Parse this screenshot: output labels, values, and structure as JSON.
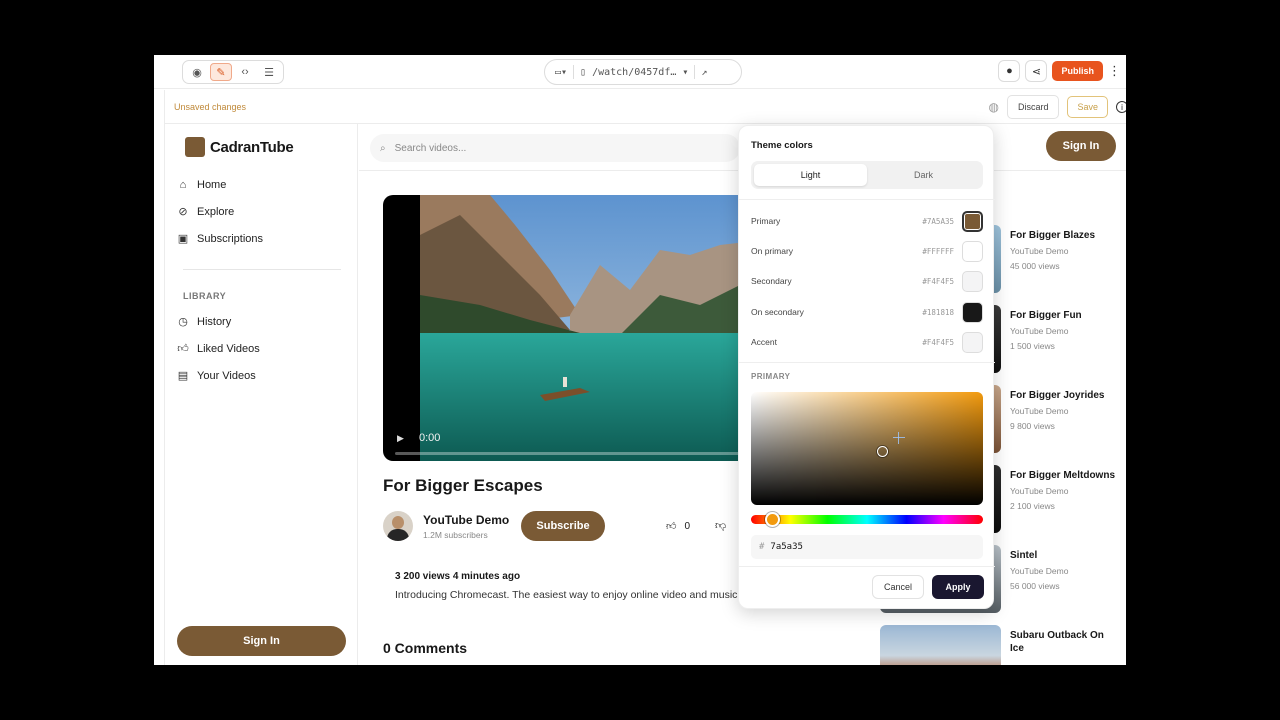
{
  "toolbar": {
    "url": "/watch/0457df…",
    "publish_label": "Publish"
  },
  "statusbar": {
    "unsaved": "Unsaved changes",
    "discard": "Discard",
    "save": "Save"
  },
  "brand": {
    "name": "CadranTube",
    "logo_color": "#7A5A35"
  },
  "sidebar": {
    "nav": [
      {
        "label": "Home",
        "icon": "home-icon"
      },
      {
        "label": "Explore",
        "icon": "compass-icon"
      },
      {
        "label": "Subscriptions",
        "icon": "subscriptions-icon"
      }
    ],
    "library_title": "LIBRARY",
    "library": [
      {
        "label": "History",
        "icon": "clock-icon"
      },
      {
        "label": "Liked Videos",
        "icon": "thumb-up-icon"
      },
      {
        "label": "Your Videos",
        "icon": "film-icon"
      }
    ],
    "signin": "Sign In"
  },
  "header": {
    "search_placeholder": "Search videos...",
    "signin": "Sign In"
  },
  "video": {
    "time": "0:00",
    "title": "For Bigger Escapes",
    "channel": "YouTube Demo",
    "subscribers": "1.2M subscribers",
    "subscribe": "Subscribe",
    "likes": "0",
    "views_line": "3 200 views  4 minutes ago",
    "description": "Introducing Chromecast. The easiest way to enjoy online video and music",
    "comments": "0 Comments"
  },
  "related": [
    {
      "title": "For Bigger Blazes",
      "channel": "YouTube Demo",
      "views": "45 000 views"
    },
    {
      "title": "For Bigger Fun",
      "channel": "YouTube Demo",
      "views": "1 500 views"
    },
    {
      "title": "For Bigger Joyrides",
      "channel": "YouTube Demo",
      "views": "9 800 views"
    },
    {
      "title": "For Bigger Meltdowns",
      "channel": "YouTube Demo",
      "views": "2 100 views"
    },
    {
      "title": "Sintel",
      "channel": "YouTube Demo",
      "views": "56 000 views"
    },
    {
      "title": "Subaru Outback On Ice",
      "channel": "",
      "views": ""
    }
  ],
  "theme_picker": {
    "title": "Theme colors",
    "tabs": [
      "Light",
      "Dark"
    ],
    "active_tab": "Light",
    "colors": [
      {
        "label": "Primary",
        "hex": "#7A5A35"
      },
      {
        "label": "On primary",
        "hex": "#FFFFFF"
      },
      {
        "label": "Secondary",
        "hex": "#F4F4F5"
      },
      {
        "label": "On secondary",
        "hex": "#181818"
      },
      {
        "label": "Accent",
        "hex": "#F4F4F5"
      }
    ],
    "section_label": "PRIMARY",
    "hex_value": "7a5a35",
    "cancel": "Cancel",
    "apply": "Apply"
  }
}
